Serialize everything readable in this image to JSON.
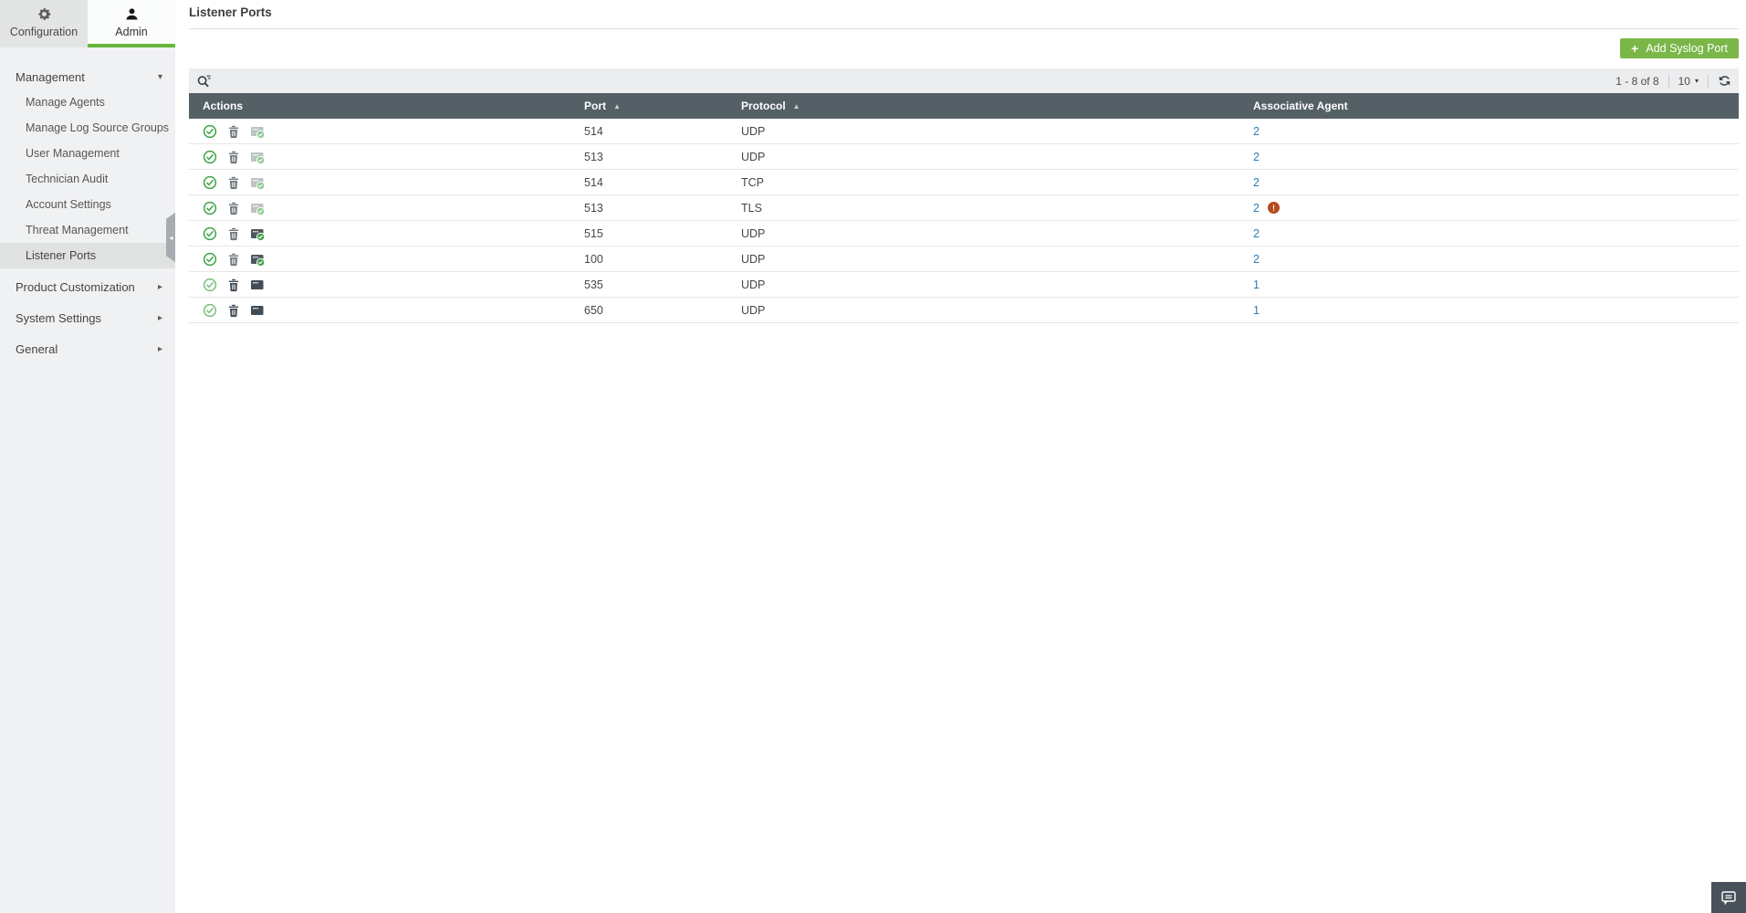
{
  "colors": {
    "accent_green": "#7ab648",
    "tab_underline_green": "#66b73c",
    "table_header_bg": "#556066",
    "link_blue": "#2d7db3",
    "warning_orange": "#b5491e"
  },
  "icons": {
    "gear-icon": "⚙",
    "admin-user-icon": "👤",
    "search-filter-icon": "🔍",
    "refresh-icon": "⟳",
    "plus-icon": "+",
    "caret-down-icon": "▾",
    "caret-right-icon": "▸",
    "sort-asc-icon": "▲",
    "collapse-sidebar-icon": "◂",
    "enable-check-icon": "✓",
    "delete-trash-icon": "🗑",
    "listener-card-icon": "▣",
    "warning-icon": "!",
    "chat-bubble-icon": "💬"
  },
  "tabs": [
    {
      "label": "Configuration",
      "icon": "gear-icon",
      "active": false
    },
    {
      "label": "Admin",
      "icon": "admin-user-icon",
      "active": true
    }
  ],
  "sidebar": {
    "sections": [
      {
        "label": "Management",
        "state": "expanded",
        "caret": "▾"
      },
      {
        "label": "Product Customization",
        "state": "collapsed",
        "caret": "▸"
      },
      {
        "label": "System Settings",
        "state": "collapsed",
        "caret": "▸"
      },
      {
        "label": "General",
        "state": "collapsed",
        "caret": "▸"
      }
    ],
    "management_items": [
      "Manage Agents",
      "Manage Log Source Groups",
      "User Management",
      "Technician Audit",
      "Account Settings",
      "Threat Management",
      "Listener Ports"
    ],
    "selected_item": "Listener Ports"
  },
  "page": {
    "title": "Listener Ports"
  },
  "toolbar": {
    "add_button": {
      "label": "Add Syslog Port",
      "icon": "plus-icon"
    }
  },
  "list_controls": {
    "search_icon": "search-filter-icon",
    "range": "1 - 8 of 8",
    "page_size": "10",
    "refresh_icon": "refresh-icon"
  },
  "table": {
    "columns": [
      {
        "label": "Actions",
        "sortable": false
      },
      {
        "label": "Port",
        "sortable": true,
        "sort": "asc"
      },
      {
        "label": "Protocol",
        "sortable": true,
        "sort": "asc"
      },
      {
        "label": "Associative Agent",
        "sortable": false
      }
    ],
    "rows": [
      {
        "port": "514",
        "protocol": "UDP",
        "agents": "2",
        "warning": false,
        "listener_icon_state": "inactive-with-check"
      },
      {
        "port": "513",
        "protocol": "UDP",
        "agents": "2",
        "warning": false,
        "listener_icon_state": "inactive-with-check"
      },
      {
        "port": "514",
        "protocol": "TCP",
        "agents": "2",
        "warning": false,
        "listener_icon_state": "inactive-with-check"
      },
      {
        "port": "513",
        "protocol": "TLS",
        "agents": "2",
        "warning": true,
        "listener_icon_state": "inactive-with-check"
      },
      {
        "port": "515",
        "protocol": "UDP",
        "agents": "2",
        "warning": false,
        "listener_icon_state": "active-with-check"
      },
      {
        "port": "100",
        "protocol": "UDP",
        "agents": "2",
        "warning": false,
        "listener_icon_state": "active-with-check"
      },
      {
        "port": "535",
        "protocol": "UDP",
        "agents": "1",
        "warning": false,
        "listener_icon_state": "plain"
      },
      {
        "port": "650",
        "protocol": "UDP",
        "agents": "1",
        "warning": false,
        "listener_icon_state": "plain"
      }
    ]
  },
  "chat": {
    "icon": "chat-bubble-icon"
  }
}
